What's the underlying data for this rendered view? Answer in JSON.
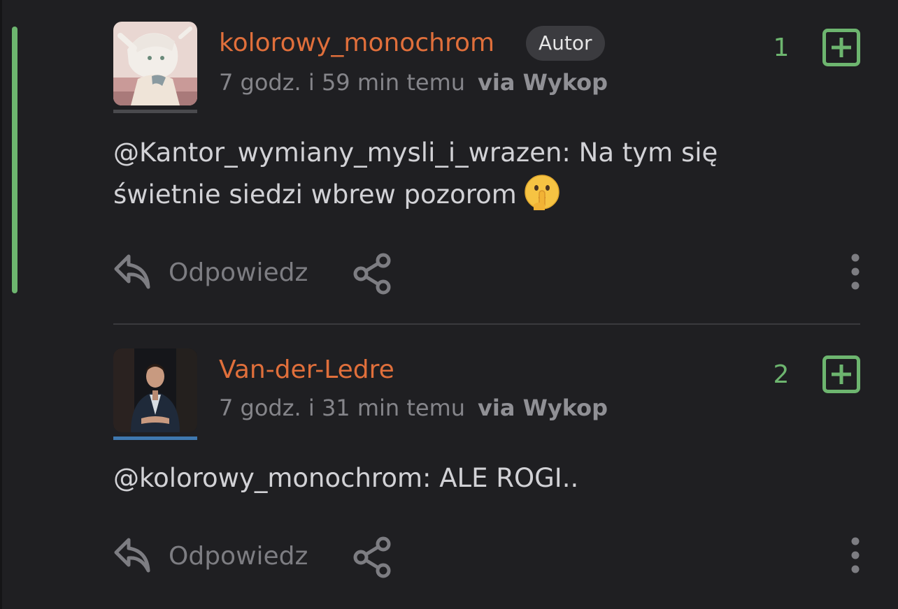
{
  "colors": {
    "background": "#1f1f22",
    "username": "#e06f3b",
    "upvote_green": "#6db56f",
    "meta_gray": "#85858a",
    "body_text": "#d2d2d6"
  },
  "comments": [
    {
      "username": "kolorowy_monochrom",
      "badge": "Autor",
      "time": "7 godz. i 59 min temu",
      "via": "via Wykop",
      "votes": "1",
      "body": "@Kantor_wymiany_mysli_i_wrazen: Na tym się świetnie siedzi wbrew pozorom",
      "emoji": "shushing-face-icon",
      "reply_label": "Odpowiedz",
      "avatar_underline_color": "#4a4a4e"
    },
    {
      "username": "Van-der-Ledre",
      "time": "7 godz. i 31 min temu",
      "via": "via Wykop",
      "votes": "2",
      "body": "@kolorowy_monochrom: ALE ROGI..",
      "reply_label": "Odpowiedz",
      "avatar_underline_color": "#3f78b0"
    }
  ]
}
